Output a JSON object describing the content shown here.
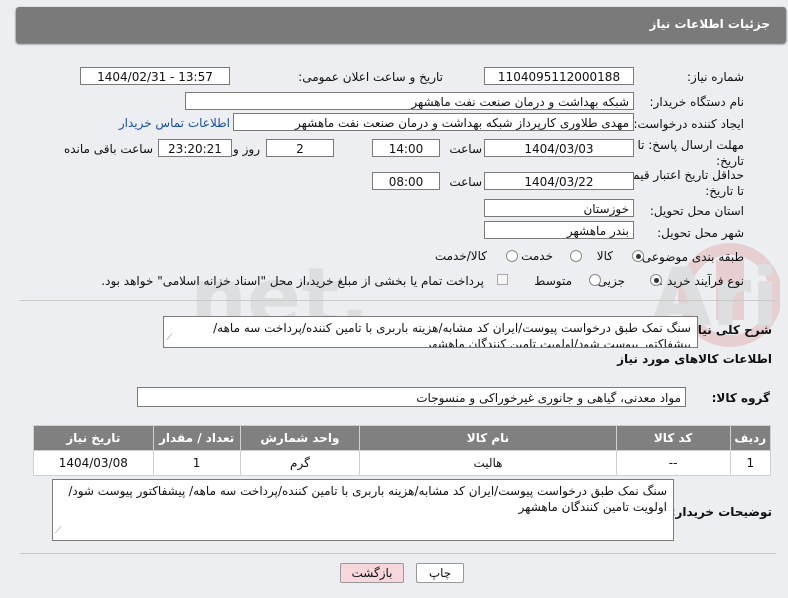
{
  "header": {
    "title": "جزئیات اطلاعات نیاز"
  },
  "form": {
    "need_number_label": "شماره نیاز:",
    "need_number": "1104095112000188",
    "announce_label": "تاریخ و ساعت اعلان عمومی:",
    "announce_value": "1404/02/31 - 13:57",
    "buyer_org_label": "نام دستگاه خریدار:",
    "buyer_org": "شبکه بهداشت و درمان صنعت نفت ماهشهر",
    "requester_label": "ایجاد کننده درخواست:",
    "requester": "مهدی طلاوری کارپرداز شبکه بهداشت و درمان صنعت نفت ماهشهر",
    "contact_link": "اطلاعات تماس خریدار",
    "reply_deadline_label": "مهلت ارسال پاسخ: تا تاریخ:",
    "reply_date": "1404/03/03",
    "time_label": "ساعت",
    "reply_time": "14:00",
    "days_value": "2",
    "days_label": "روز و",
    "remaining_time": "23:20:21",
    "remaining_label": "ساعت باقی مانده",
    "price_validity_label": "حداقل تاریخ اعتبار قیمت: تا تاریخ:",
    "price_date": "1404/03/22",
    "price_time": "08:00",
    "province_label": "استان محل تحویل:",
    "province": "خوزستان",
    "city_label": "شهر محل تحویل:",
    "city": "بندر ماهشهر",
    "category_label": "طبقه بندی موضوعی:",
    "category_options": [
      "کالا",
      "خدمت",
      "کالا/خدمت"
    ],
    "category_selected": "کالا",
    "process_label": "نوع فرآیند خرید :",
    "process_options": [
      "جزیی",
      "متوسط"
    ],
    "process_selected": "جزیی",
    "payment_note": "پرداخت تمام یا بخشی از مبلغ خرید،از محل \"اسناد خزانه اسلامی\" خواهد بود."
  },
  "summary": {
    "label": "شرح کلی نیاز:",
    "text": "سنگ نمک طبق درخواست پیوست/ایران کد مشابه/هزینه باربری با تامین کننده/پرداخت سه ماهه/ پیشفاکتور پیوست شود/اولویت تامین کنندگان ماهشهر"
  },
  "goods": {
    "section_title": "اطلاعات کالاهای مورد نیاز",
    "group_label": "گروه کالا:",
    "group_value": "مواد معدنی، گیاهی و جانوری غیرخوراکی و منسوجات",
    "columns": [
      "ردیف",
      "کد کالا",
      "نام کالا",
      "واحد شمارش",
      "تعداد / مقدار",
      "تاریخ نیاز"
    ],
    "rows": [
      {
        "row": "1",
        "code": "--",
        "name": "هالیت",
        "unit": "گرم",
        "qty": "1",
        "date": "1404/03/08"
      }
    ]
  },
  "buyer_notes": {
    "label": "توضیحات خریدار:",
    "text": "سنگ نمک طبق درخواست پیوست/ایران کد مشابه/هزینه باربری با تامین کننده/پرداخت سه ماهه/ پیشفاکتور پیوست شود/اولویت تامین کنندگان ماهشهر"
  },
  "buttons": {
    "print": "چاپ",
    "back": "بازگشت"
  },
  "colors": {
    "titlebar": "#7a7a7a",
    "table_header": "#808080",
    "link": "#1a4fa0",
    "back_button": "#f8d7dc"
  }
}
